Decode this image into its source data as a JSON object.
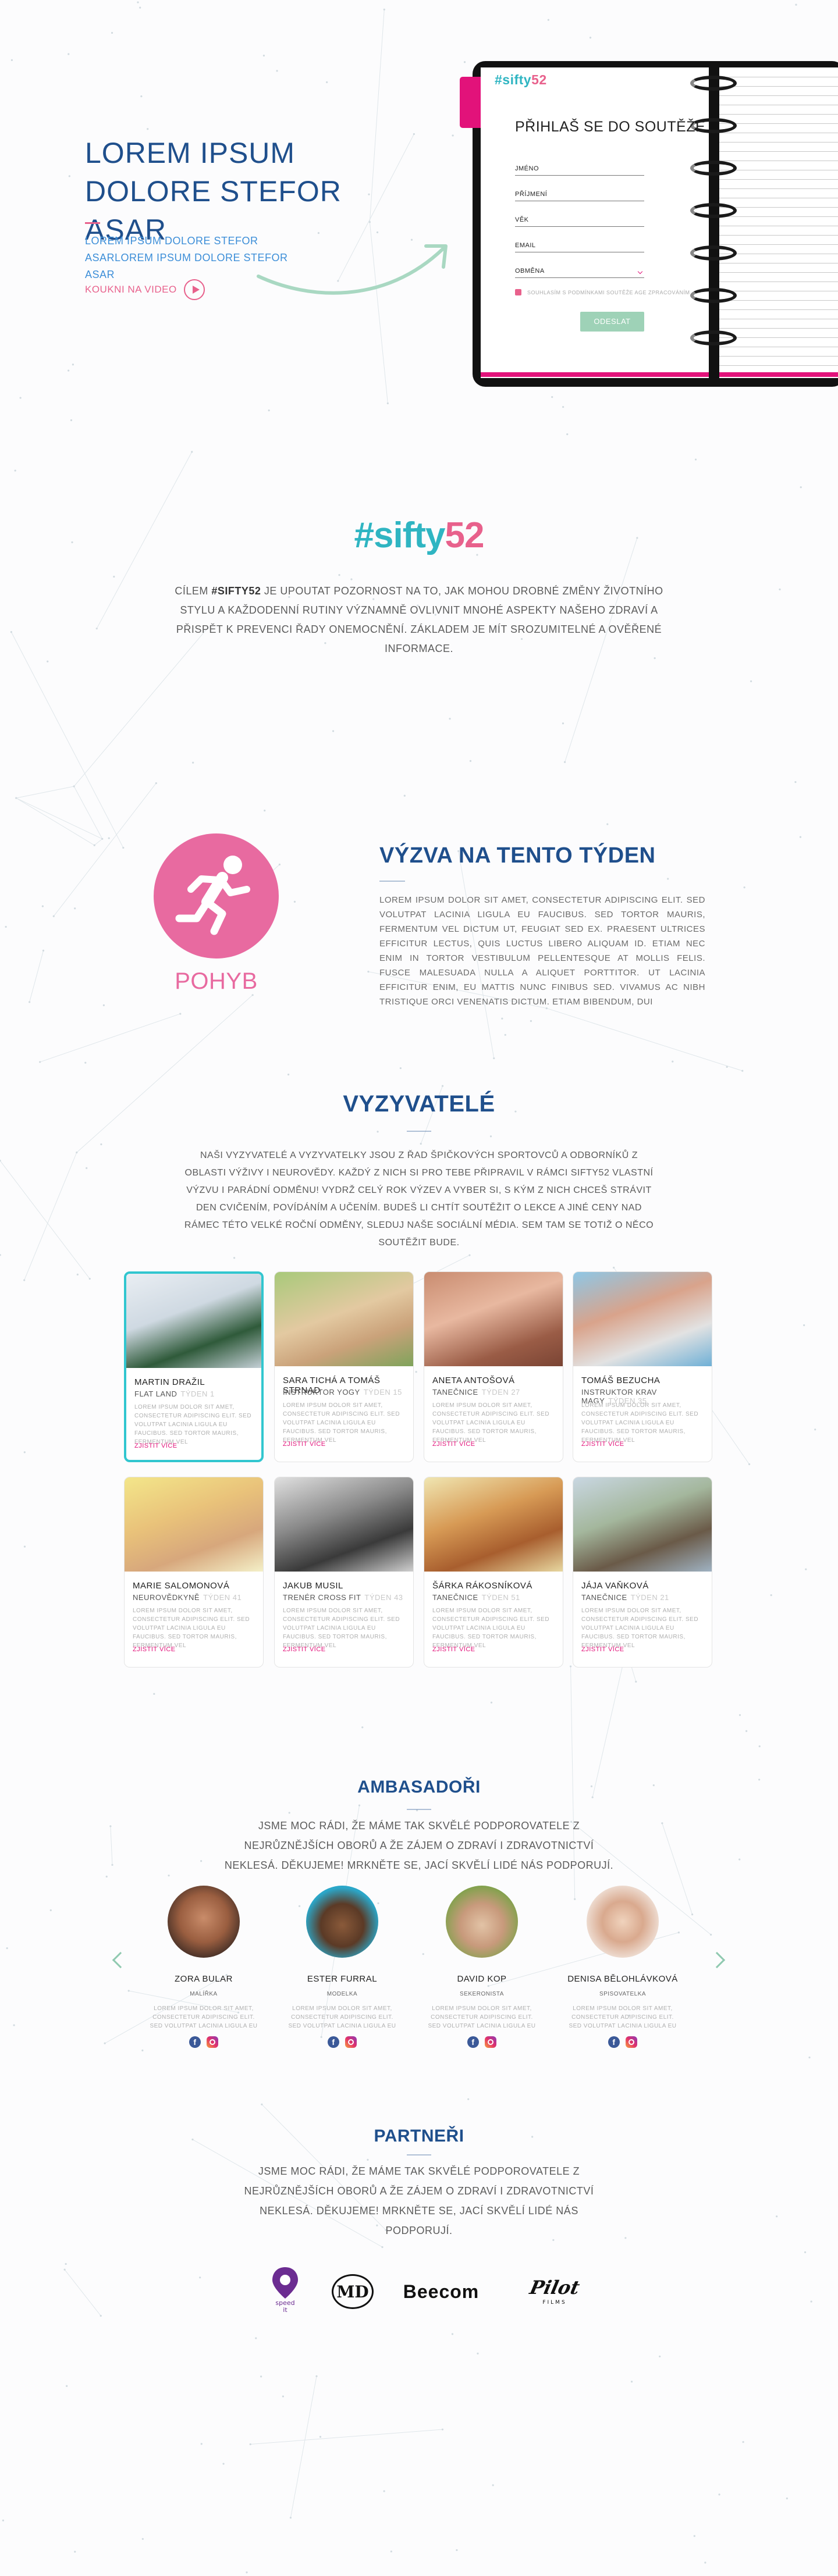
{
  "hero": {
    "title": "LOREM IPSUM DOLORE STEFOR ASAR",
    "subtitle": "LOREM IPSUM DOLORE STEFOR ASARLOREM IPSUM DOLORE STEFOR ASAR",
    "video_label": "KOUKNI NA VIDEO"
  },
  "form": {
    "brand_hash": "#sifty",
    "brand_num": "52",
    "title": "PŘIHLAŠ SE DO SOUTĚŽE",
    "fields": {
      "name": "JMÉNO",
      "surname": "PŘÍJMENÍ",
      "age": "VĚK",
      "email": "EMAIL",
      "region": "OBMĚNA"
    },
    "consent": "SOUHLASÍM S PODMÍNKAMI SOUTĚŽE AGE ZPRACOVÁNÍM",
    "submit": "ODESLAT"
  },
  "about": {
    "logo_hash": "#sifty",
    "logo_num": "52",
    "text_before": "CÍLEM ",
    "text_bold": "#SIFTY52",
    "text_after": " JE UPOUTAT POZORNOST NA TO, JAK MOHOU DROBNÉ ZMĚNY ŽIVOTNÍHO STYLU A KAŽDODENNÍ RUTINY VÝZNAMNĚ OVLIVNIT MNOHÉ ASPEKTY NAŠEHO ZDRAVÍ A PŘISPĚT K PREVENCI ŘADY ONEMOCNĚNÍ. ZÁKLADEM JE MÍT SROZUMITELNÉ A OVĚŘENÉ INFORMACE."
  },
  "challenge": {
    "icon_label": "POHYB",
    "title": "VÝZVA NA TENTO TÝDEN",
    "text": "LOREM IPSUM DOLOR SIT AMET, CONSECTETUR ADIPISCING ELIT. SED VOLUTPAT LACINIA LIGULA EU FAUCIBUS. SED TORTOR MAURIS, FERMENTUM VEL DICTUM UT, FEUGIAT SED EX. PRAESENT ULTRICES EFFICITUR LECTUS, QUIS LUCTUS LIBERO ALIQUAM ID. ETIAM NEC ENIM IN TORTOR VESTIBULUM PELLENTESQUE AT MOLLIS FELIS. FUSCE MALESUADA NULLA A ALIQUET PORTTITOR. UT LACINIA EFFICITUR ENIM, EU MATTIS NUNC FINIBUS SED. VIVAMUS AC NIBH TRISTIQUE ORCI VENENATIS DICTUM. ETIAM BIBENDUM, DUI"
  },
  "challengers": {
    "title": "VYZYVATELÉ",
    "text": "NAŠI VYZYVATELÉ A VYZYVATELKY JSOU Z ŘAD ŠPIČKOVÝCH SPORTOVCŮ A ODBORNÍKŮ Z OBLASTI VÝŽIVY I NEUROVĚDY. KAŽDÝ Z NICH SI PRO TEBE PŘIPRAVIL V RÁMCI SIFTY52 VLASTNÍ VÝZVU I PARÁDNÍ ODMĚNU! VYDRŽ CELÝ ROK VÝZEV A VYBER SI, S KÝM Z NICH CHCEŠ STRÁVIT DEN CVIČENÍM, POVÍDÁNÍM A UČENÍM. BUDEŠ LI CHTÍT SOUTĚŽIT O LEKCE A JINÉ CENY NAD RÁMEC TÉTO VELKÉ ROČNÍ ODMĚNY, SLEDUJ NAŠE SOCIÁLNÍ MÉDIA. SEM TAM SE TOTIŽ O NĚCO SOUTĚŽIT BUDE.",
    "card_text": "LOREM IPSUM DOLOR SIT AMET, CONSECTETUR ADIPISCING ELIT. SED VOLUTPAT LACINIA LIGULA EU FAUCIBUS. SED TORTOR MAURIS, FERMENTUM VEL",
    "more_label": "ZJISTIT VÍCE",
    "cards": [
      {
        "name": "MARTIN DRAŽIL",
        "role": "FLAT LAND",
        "week": "TÝDEN 1"
      },
      {
        "name": "SARA TICHÁ A TOMÁŠ STRNAD",
        "role": "INSTRUKTOR YOGY",
        "week": "TÝDEN 15"
      },
      {
        "name": "ANETA ANTOŠOVÁ",
        "role": "TANEČNICE",
        "week": "TÝDEN 27"
      },
      {
        "name": "TOMÁŠ BEZUCHA",
        "role": "INSTRUKTOR KRAV MAGY",
        "week": "TÝDEN 35"
      },
      {
        "name": "MARIE SALOMONOVÁ",
        "role": "NEUROVĚDKYNĚ",
        "week": "TÝDEN 41"
      },
      {
        "name": "JAKUB MUSIL",
        "role": "TRENÉR CROSS FIT",
        "week": "TÝDEN 43"
      },
      {
        "name": "ŠÁRKA RÁKOSNÍKOVÁ",
        "role": "TANEČNICE",
        "week": "TÝDEN 51"
      },
      {
        "name": "JÁJA VAŇKOVÁ",
        "role": "TANEČNICE",
        "week": "TÝDEN 21"
      }
    ]
  },
  "ambassadors": {
    "title": "AMBASADOŘI",
    "text": "JSME MOC RÁDI, ŽE MÁME TAK SKVĚLÉ PODPOROVATELE Z NEJRŮZNĚJŠÍCH OBORŮ A ŽE ZÁJEM O ZDRAVÍ I ZDRAVOTNICTVÍ NEKLESÁ. DĚKUJEME! MRKNĚTE SE, JACÍ SKVĚLÍ LIDÉ NÁS PODPORUJÍ.",
    "card_text": "LOREM IPSUM DOLOR SIT AMET, CONSECTETUR ADIPISCING ELIT. SED VOLUTPAT LACINIA LIGULA EU",
    "people": [
      {
        "name": "ZORA BULAR",
        "role": "MALÍŘKA"
      },
      {
        "name": "ESTER FURRAL",
        "role": "MODELKA"
      },
      {
        "name": "DAVID KOP",
        "role": "SEKERONISTA"
      },
      {
        "name": "DENISA BĚLOHLÁVKOVÁ",
        "role": "SPISOVATELKA"
      }
    ]
  },
  "partners": {
    "title": "PARTNEŘI",
    "text": "JSME MOC RÁDI, ŽE MÁME TAK SKVĚLÉ PODPOROVATELE Z NEJRŮZNĚJŠÍCH OBORŮ A ŽE ZÁJEM O ZDRAVÍ I ZDRAVOTNICTVÍ NEKLESÁ. DĚKUJEME! MRKNĚTE SE, JACÍ SKVĚLÍ LIDÉ NÁS PODPORUJÍ.",
    "logos": {
      "speed_line1": "speed",
      "speed_line2": "it",
      "md": "MD",
      "beecom": "Beecom",
      "films_script": "Pilot",
      "films_sub": "FILMS"
    }
  },
  "colors": {
    "brand_teal": "#2fb5c2",
    "brand_pink": "#e8618c",
    "navy": "#1f4f8c",
    "accent_magenta": "#e2127a",
    "mint": "#9ed2b7"
  }
}
